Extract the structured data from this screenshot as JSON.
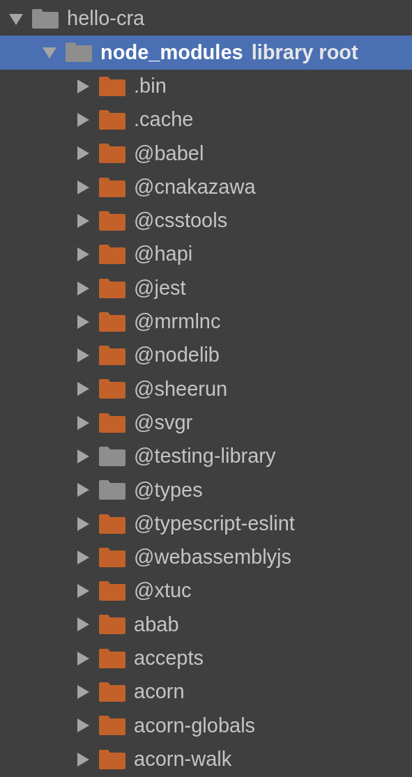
{
  "tree": [
    {
      "label": "hello-cra",
      "expanded": true,
      "selected": false,
      "color": "#8e8e8e",
      "children": [
        {
          "label": "node_modules",
          "note": "library root",
          "expanded": true,
          "selected": true,
          "color": "#8e8e8e",
          "children": [
            {
              "label": ".bin",
              "expanded": false,
              "selected": false,
              "color": "#c2622a"
            },
            {
              "label": ".cache",
              "expanded": false,
              "selected": false,
              "color": "#c2622a"
            },
            {
              "label": "@babel",
              "expanded": false,
              "selected": false,
              "color": "#c2622a"
            },
            {
              "label": "@cnakazawa",
              "expanded": false,
              "selected": false,
              "color": "#c2622a"
            },
            {
              "label": "@csstools",
              "expanded": false,
              "selected": false,
              "color": "#c2622a"
            },
            {
              "label": "@hapi",
              "expanded": false,
              "selected": false,
              "color": "#c2622a"
            },
            {
              "label": "@jest",
              "expanded": false,
              "selected": false,
              "color": "#c2622a"
            },
            {
              "label": "@mrmlnc",
              "expanded": false,
              "selected": false,
              "color": "#c2622a"
            },
            {
              "label": "@nodelib",
              "expanded": false,
              "selected": false,
              "color": "#c2622a"
            },
            {
              "label": "@sheerun",
              "expanded": false,
              "selected": false,
              "color": "#c2622a"
            },
            {
              "label": "@svgr",
              "expanded": false,
              "selected": false,
              "color": "#c2622a"
            },
            {
              "label": "@testing-library",
              "expanded": false,
              "selected": false,
              "color": "#8e8e8e"
            },
            {
              "label": "@types",
              "expanded": false,
              "selected": false,
              "color": "#8e8e8e"
            },
            {
              "label": "@typescript-eslint",
              "expanded": false,
              "selected": false,
              "color": "#c2622a"
            },
            {
              "label": "@webassemblyjs",
              "expanded": false,
              "selected": false,
              "color": "#c2622a"
            },
            {
              "label": "@xtuc",
              "expanded": false,
              "selected": false,
              "color": "#c2622a"
            },
            {
              "label": "abab",
              "expanded": false,
              "selected": false,
              "color": "#c2622a"
            },
            {
              "label": "accepts",
              "expanded": false,
              "selected": false,
              "color": "#c2622a"
            },
            {
              "label": "acorn",
              "expanded": false,
              "selected": false,
              "color": "#c2622a"
            },
            {
              "label": "acorn-globals",
              "expanded": false,
              "selected": false,
              "color": "#c2622a"
            },
            {
              "label": "acorn-walk",
              "expanded": false,
              "selected": false,
              "color": "#c2622a"
            }
          ]
        }
      ]
    }
  ]
}
